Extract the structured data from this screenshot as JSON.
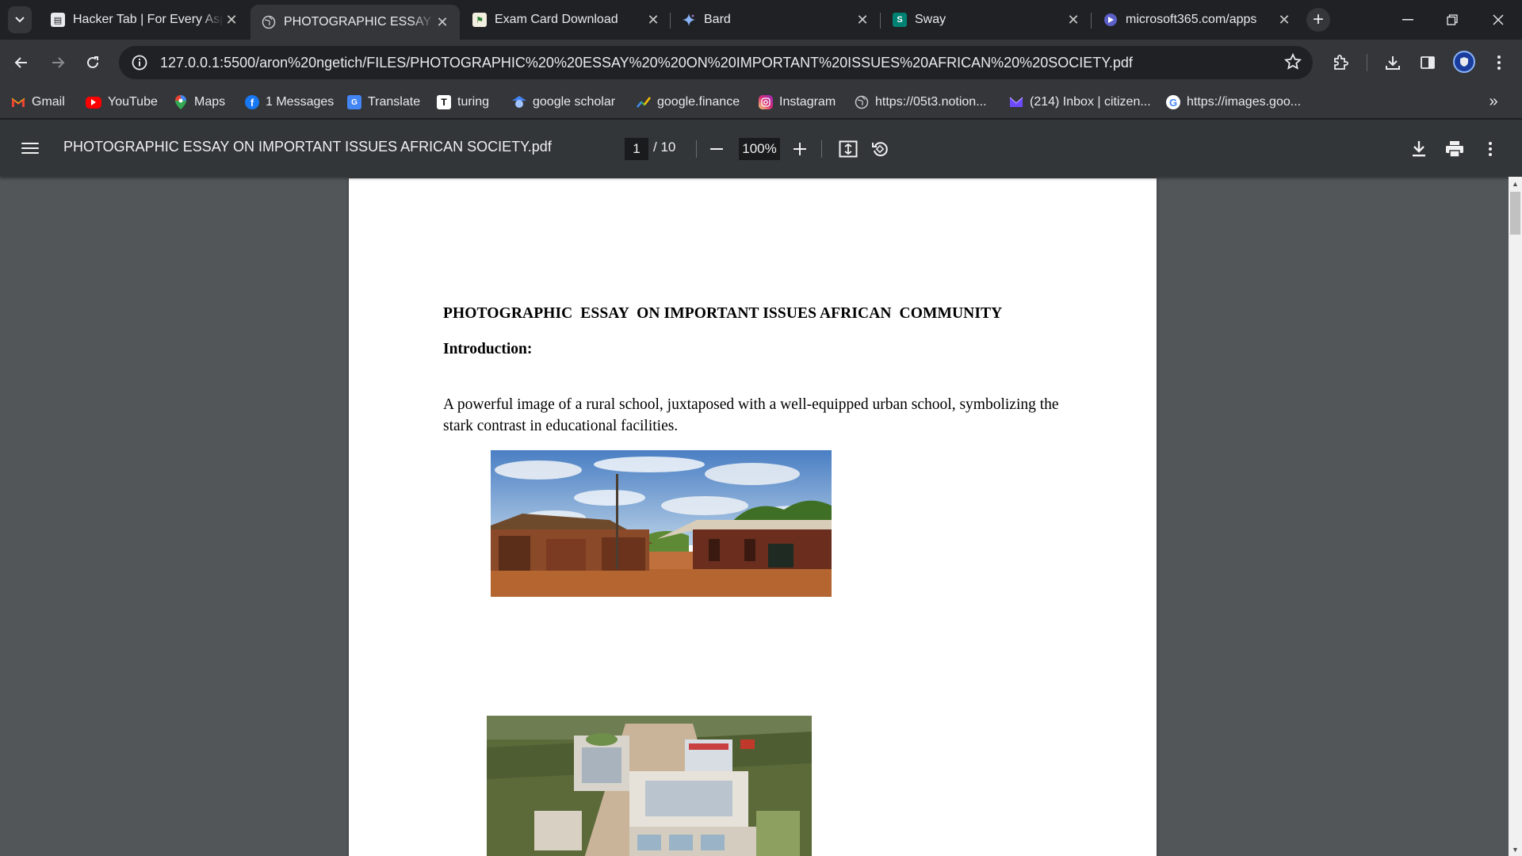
{
  "tabs": [
    {
      "title": "Hacker Tab | For Every Aspiring Developer",
      "favicon": "hacker-tab-icon"
    },
    {
      "title": "PHOTOGRAPHIC ESSAY ON IMPORTANT ISSUES AFRICAN SOCIETY.pdf",
      "favicon": "globe-icon",
      "active": true
    },
    {
      "title": "Exam Card Download",
      "favicon": "exam-card-icon"
    },
    {
      "title": "Bard",
      "favicon": "bard-sparkle-icon"
    },
    {
      "title": "Sway",
      "favicon": "sway-icon"
    },
    {
      "title": "microsoft365.com/apps",
      "favicon": "microsoft365-icon"
    }
  ],
  "address_bar": {
    "url": "127.0.0.1:5500/aron%20ngetich/FILES/PHOTOGRAPHIC%20%20ESSAY%20%20ON%20IMPORTANT%20ISSUES%20AFRICAN%20%20SOCIETY.pdf"
  },
  "bookmarks": [
    {
      "label": "Gmail",
      "icon": "gmail-icon"
    },
    {
      "label": "YouTube",
      "icon": "youtube-icon"
    },
    {
      "label": "Maps",
      "icon": "maps-icon"
    },
    {
      "label": "1 Messages",
      "icon": "facebook-icon"
    },
    {
      "label": "Translate",
      "icon": "translate-icon"
    },
    {
      "label": "turing",
      "icon": "turing-icon"
    },
    {
      "label": "google scholar",
      "icon": "google-scholar-icon"
    },
    {
      "label": "google.finance",
      "icon": "google-finance-icon"
    },
    {
      "label": "Instagram",
      "icon": "instagram-icon"
    },
    {
      "label": "https://05t3.notion...",
      "icon": "globe-icon"
    },
    {
      "label": "(214) Inbox | citizen...",
      "icon": "proton-mail-icon"
    },
    {
      "label": "https://images.goo...",
      "icon": "google-icon"
    }
  ],
  "pdf_viewer": {
    "filename": "PHOTOGRAPHIC ESSAY ON IMPORTANT ISSUES AFRICAN SOCIETY.pdf",
    "current_page": "1",
    "total_pages": "/ 10",
    "zoom": "100%"
  },
  "document": {
    "title": "PHOTOGRAPHIC  ESSAY  ON IMPORTANT ISSUES AFRICAN  COMMUNITY",
    "intro_heading": "Introduction:",
    "paragraph": "A powerful image of a rural school, juxtaposed with a well-equipped urban school, symbolizing the stark contrast in educational facilities."
  },
  "colors": {
    "tabstrip": "#202124",
    "toolbar": "#35363a",
    "pdf_toolbar": "#323639",
    "viewer_bg": "#525659"
  }
}
